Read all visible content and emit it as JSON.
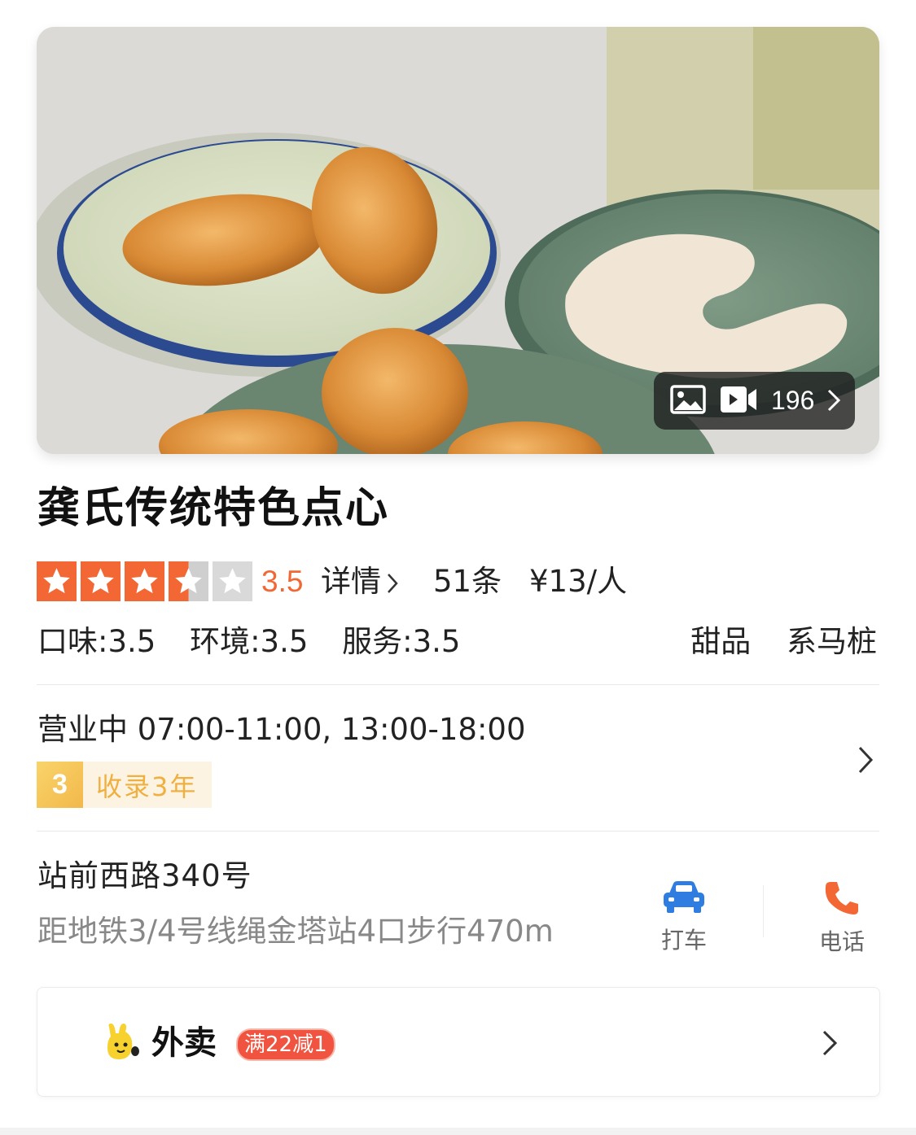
{
  "hero": {
    "media_count": "196",
    "icons": [
      "image-icon",
      "video-icon",
      "chevron-right-icon"
    ]
  },
  "shop": {
    "name": "龚氏传统特色点心",
    "rating": 3.5,
    "rating_text": "3.5",
    "detail_label": "详情",
    "reviews": "51条",
    "price": "¥13/人",
    "sub_scores": {
      "taste": "口味:3.5",
      "environment": "环境:3.5",
      "service": "服务:3.5"
    },
    "tags": [
      "甜品",
      "系马桩"
    ]
  },
  "hours": {
    "text": "营业中 07:00-11:00, 13:00-18:00",
    "badge_number": "3",
    "badge_text": "收录3年"
  },
  "location": {
    "address": "站前西路340号",
    "metro": "距地铁3/4号线绳金塔站4口步行470m",
    "actions": [
      {
        "label": "打车",
        "icon": "car-icon",
        "color": "#2f7de1"
      },
      {
        "label": "电话",
        "icon": "phone-icon",
        "color": "#f26733"
      }
    ]
  },
  "takeout": {
    "label": "外卖",
    "promo": "满22减1",
    "icon": "takeout-mascot-icon"
  },
  "colors": {
    "accent": "#f26733",
    "badge_gold": "#f2b84b",
    "promo_red": "#f0533f"
  }
}
